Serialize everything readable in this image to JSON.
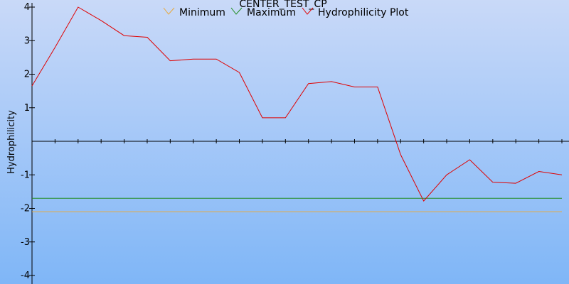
{
  "chart_data": {
    "type": "line",
    "title": "CENTER_TEST_CP",
    "xlabel": "",
    "ylabel": "Hydrophilicity",
    "ylim": [
      -4,
      4
    ],
    "y_ticks": [
      "4",
      "3",
      "2",
      "1",
      "-1",
      "-2",
      "-3",
      "-4"
    ],
    "y_tick_values": [
      4,
      3,
      2,
      1,
      -1,
      -2,
      -3,
      -4
    ],
    "xlim": [
      0,
      23
    ],
    "x_ticks_count": 24,
    "grid": false,
    "legend": "top",
    "colors": {
      "background_top": "#c9d9f8",
      "background_bottom": "#7fb6f7",
      "minimum": "#e8a83a",
      "maximum": "#1e8c1e",
      "hydrophilicity": "#e00000",
      "axis": "#000000"
    },
    "series": [
      {
        "name": "Minimum",
        "x": [
          0,
          23
        ],
        "values": [
          -2.1,
          -2.1
        ]
      },
      {
        "name": "Maximum",
        "x": [
          0,
          23
        ],
        "values": [
          -1.7,
          -1.7
        ]
      },
      {
        "name": "Hydrophilicity Plot",
        "x": [
          0,
          1,
          2,
          3,
          4,
          5,
          6,
          7,
          8,
          9,
          10,
          11,
          12,
          13,
          14,
          15,
          16,
          17,
          18,
          19,
          20,
          21,
          22,
          23
        ],
        "values": [
          1.65,
          2.8,
          4.0,
          3.6,
          3.15,
          3.1,
          2.4,
          2.45,
          2.45,
          2.05,
          0.7,
          0.7,
          1.72,
          1.78,
          1.62,
          1.62,
          -0.4,
          -1.78,
          -1.0,
          -0.55,
          -1.22,
          -1.25,
          -0.9,
          -1.0
        ]
      }
    ]
  }
}
